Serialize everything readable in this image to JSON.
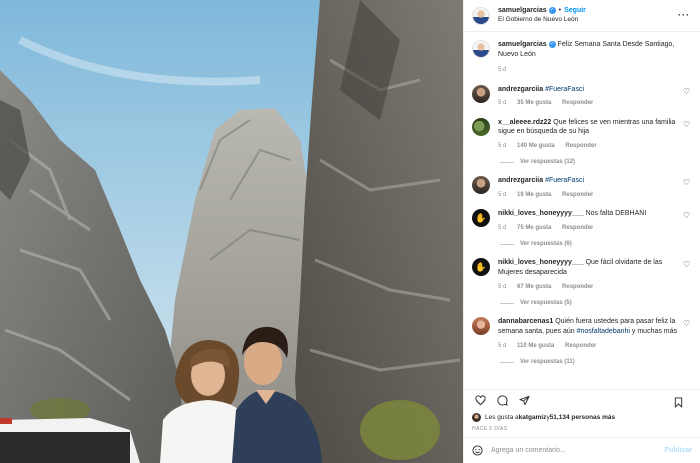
{
  "post": {
    "username": "samuelgarcias",
    "follow_label": "Seguir",
    "location": "El Gobierno de Nuevo León",
    "caption_text": "Feliz Semana Santa Desde Santiago, Nuevo León",
    "caption_time": "5 d"
  },
  "comments": [
    {
      "user": "andrezgarciia",
      "text": "#FueraFasci",
      "time": "5 d",
      "likes": "35 Me gusta",
      "reply": "Responder",
      "view_replies": ""
    },
    {
      "user": "x__aleeee.rdz22",
      "text": "Que felices se ven mientras una familia sigue en búsqueda de su hija",
      "time": "5 d",
      "likes": "140 Me gusta",
      "reply": "Responder",
      "view_replies": "Ver respuestas (12)"
    },
    {
      "user": "andrezgarciia",
      "text": "#FueraFasci",
      "time": "5 d",
      "likes": "19 Me gusta",
      "reply": "Responder",
      "view_replies": ""
    },
    {
      "user": "nikki_loves_honeyyyy___",
      "text": "Nos falta DEBHANI",
      "time": "5 d",
      "likes": "75 Me gusta",
      "reply": "Responder",
      "view_replies": "Ver respuestas (6)"
    },
    {
      "user": "nikki_loves_honeyyyy___",
      "text": "Que fácil olvidarte de las Mujeres desaparecida",
      "time": "5 d",
      "likes": "67 Me gusta",
      "reply": "Responder",
      "view_replies": "Ver respuestas (5)"
    },
    {
      "user": "dannabarcenas1",
      "text_plain": "Quién fuera ustedes para pasar feliz la semana santa, pues aún ",
      "text_tag": "#nosfaltadebanhi",
      "text_end": " y muchas más",
      "time": "5 d",
      "likes": "110 Me gusta",
      "reply": "Responder",
      "view_replies": "Ver respuestas (11)"
    }
  ],
  "likes_bar": {
    "prefix": "Les gusta a ",
    "user": "katgamiz",
    "middle": " y ",
    "count": "51,134 personas más"
  },
  "time_ago": "Hace 5 días",
  "comment_box": {
    "placeholder": "Agrega un comentario...",
    "publish": "Publicar"
  },
  "icons": [
    "verified-icon",
    "more-icon",
    "heart-icon",
    "comment-icon",
    "share-icon",
    "save-icon",
    "emoji-icon"
  ],
  "colors": {
    "link": "#0095f6",
    "hashtag": "#00376b",
    "muted": "#8e8e8e",
    "verified": "#3897f0"
  }
}
